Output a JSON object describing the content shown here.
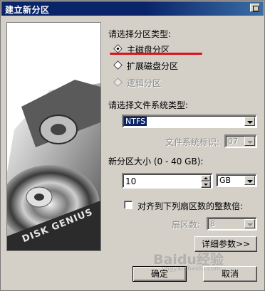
{
  "window": {
    "title": "建立新分区"
  },
  "partition_type": {
    "heading": "请选择分区类型:",
    "options": [
      {
        "label": "主磁盘分区",
        "checked": true,
        "enabled": true
      },
      {
        "label": "扩展磁盘分区",
        "checked": false,
        "enabled": true
      },
      {
        "label": "逻辑分区",
        "checked": false,
        "enabled": false
      }
    ]
  },
  "filesystem": {
    "heading": "请选择文件系统类型:",
    "selected": "NTFS",
    "id_label": "文件系统标识:",
    "id_value": "07"
  },
  "size": {
    "label": "新分区大小 (0 - 40 GB):",
    "value": "10",
    "unit": "GB"
  },
  "align": {
    "label": "对齐到下列扇区数的整数倍:",
    "checked": false,
    "sectors_label": "扇区数:",
    "sectors_value": "8"
  },
  "buttons": {
    "details": "详细参数>>",
    "ok": "确定",
    "cancel": "取消"
  },
  "art": {
    "brand": "DISK GENIUS"
  },
  "watermark": {
    "text": "Baidu经验",
    "sub": "jingyan.baidu.com"
  },
  "colors": {
    "accent_line": "#d8141c",
    "titlebar": "#0a246a",
    "selection": "#0a246a"
  }
}
